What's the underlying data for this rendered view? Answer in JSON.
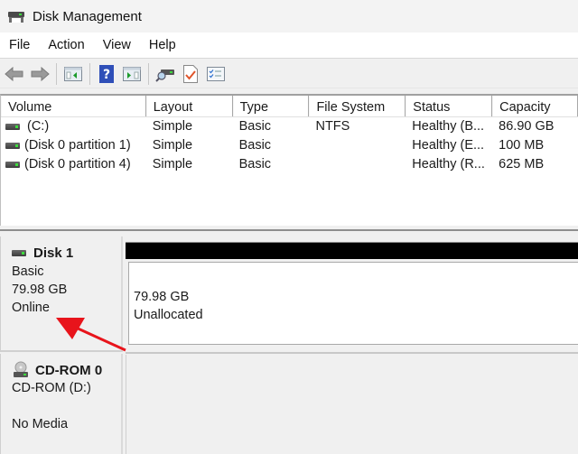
{
  "window": {
    "title": "Disk Management",
    "icon": "disk-management-icon"
  },
  "menu": [
    "File",
    "Action",
    "View",
    "Help"
  ],
  "toolbar": {
    "buttons": [
      {
        "name": "back",
        "icon": "back-arrow-icon"
      },
      {
        "name": "forward",
        "icon": "forward-arrow-icon"
      },
      {
        "name": "show-hide-console-tree",
        "icon": "console-tree-icon"
      },
      {
        "name": "help",
        "icon": "help-icon",
        "glyph": "?"
      },
      {
        "name": "show-hide-action-pane",
        "icon": "action-pane-icon"
      },
      {
        "name": "connect-disk",
        "icon": "connect-drive-icon"
      },
      {
        "name": "properties",
        "icon": "checked-document-icon"
      },
      {
        "name": "checklist",
        "icon": "checklist-icon"
      }
    ]
  },
  "volume_table": {
    "columns": [
      "Volume",
      "Layout",
      "Type",
      "File System",
      "Status",
      "Capacity"
    ],
    "rows": [
      {
        "volume": "(C:)",
        "layout": "Simple",
        "type": "Basic",
        "file_system": "NTFS",
        "status": "Healthy (B...",
        "capacity": "86.90 GB"
      },
      {
        "volume": "(Disk 0 partition 1)",
        "layout": "Simple",
        "type": "Basic",
        "file_system": "",
        "status": "Healthy (E...",
        "capacity": "100 MB"
      },
      {
        "volume": "(Disk 0 partition 4)",
        "layout": "Simple",
        "type": "Basic",
        "file_system": "",
        "status": "Healthy (R...",
        "capacity": "625 MB"
      }
    ]
  },
  "disks": [
    {
      "name": "Disk 1",
      "type": "Basic",
      "size": "79.98 GB",
      "state": "Online",
      "partition": {
        "size": "79.98 GB",
        "label": "Unallocated",
        "bar_color": "#000000"
      }
    },
    {
      "name": "CD-ROM 0",
      "type": "CD-ROM (D:)",
      "state": "No Media"
    }
  ],
  "annotation": {
    "type": "arrow",
    "color": "#e8141b",
    "points_to": "Online"
  }
}
